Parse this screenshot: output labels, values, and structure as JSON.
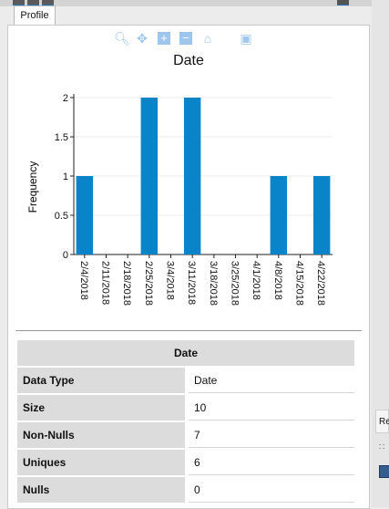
{
  "tab": {
    "label": "Profile"
  },
  "toolbar_icons": [
    "zoom-icon",
    "pan-icon",
    "zoom-in-icon",
    "zoom-out-icon",
    "home-icon",
    "save-icon"
  ],
  "chart_data": {
    "type": "bar",
    "title": "Date",
    "xlabel": "",
    "ylabel": "Frequency",
    "categories": [
      "2/4/2018",
      "2/11/2018",
      "2/18/2018",
      "2/25/2018",
      "3/4/2018",
      "3/11/2018",
      "3/18/2018",
      "3/25/2018",
      "4/1/2018",
      "4/8/2018",
      "4/15/2018",
      "4/22/2018"
    ],
    "values": [
      1,
      0,
      0,
      2,
      0,
      2,
      0,
      0,
      0,
      1,
      0,
      1
    ],
    "yticks": [
      "0",
      "0.5",
      "1",
      "1.5",
      "2"
    ],
    "ylim": [
      0,
      2
    ],
    "bar_color": "#0a84c9"
  },
  "table": {
    "title": "Date",
    "rows": [
      {
        "key": "Data Type",
        "value": "Date"
      },
      {
        "key": "Size",
        "value": "10"
      },
      {
        "key": "Non-Nulls",
        "value": "7"
      },
      {
        "key": "Uniques",
        "value": "6"
      },
      {
        "key": "Nulls",
        "value": "0"
      }
    ]
  },
  "side_panel": {
    "tab_label": "Re"
  }
}
